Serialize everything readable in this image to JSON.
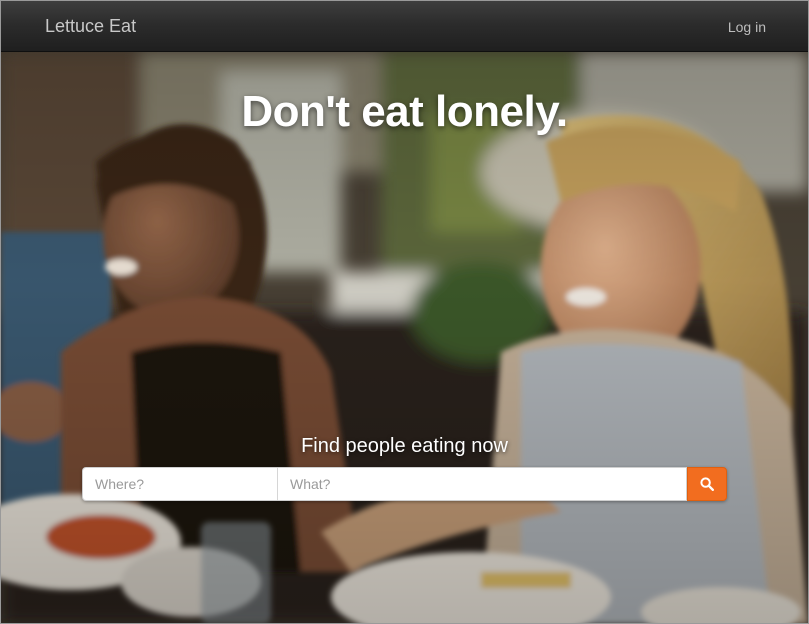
{
  "navbar": {
    "brand": "Lettuce Eat",
    "login_label": "Log in"
  },
  "hero": {
    "headline": "Don't eat lonely.",
    "subhead": "Find people eating now",
    "search": {
      "where_placeholder": "Where?",
      "what_placeholder": "What?",
      "button_icon": "search-icon"
    }
  },
  "colors": {
    "accent": "#f26d1f",
    "navbar": "#2c2c2c"
  }
}
